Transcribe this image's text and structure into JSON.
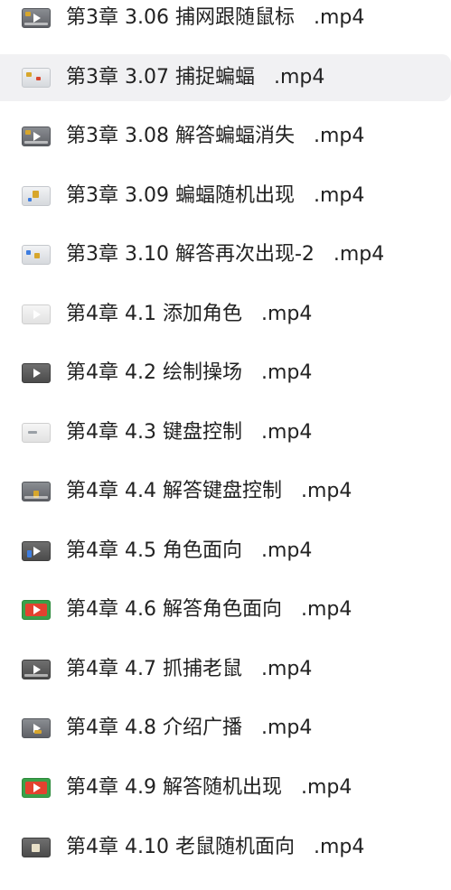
{
  "files": [
    {
      "name": "第3章 3.06 捕网跟随鼠标   .mp4",
      "thumb": "mid-gray-icon"
    },
    {
      "name": "第3章 3.07 捕捉蝙蝠   .mp4",
      "thumb": "light-gray-icon",
      "selected": true
    },
    {
      "name": "第3章 3.08 解答蝙蝠消失   .mp4",
      "thumb": "mid-gray-icon"
    },
    {
      "name": "第3章 3.09 蝙蝠随机出现   .mp4",
      "thumb": "light-gray-icon"
    },
    {
      "name": "第3章 3.10 解答再次出现-2   .mp4",
      "thumb": "light-gray-icon"
    },
    {
      "name": "第4章 4.1 添加角色   .mp4",
      "thumb": "pale-icon"
    },
    {
      "name": "第4章 4.2 绘制操场   .mp4",
      "thumb": "dark-gray-icon"
    },
    {
      "name": "第4章 4.3 键盘控制   .mp4",
      "thumb": "pale-icon"
    },
    {
      "name": "第4章 4.4 解答键盘控制   .mp4",
      "thumb": "mid-gray-icon"
    },
    {
      "name": "第4章 4.5 角色面向   .mp4",
      "thumb": "dark-gray-icon"
    },
    {
      "name": "第4章 4.6 解答角色面向   .mp4",
      "thumb": "green-red-icon"
    },
    {
      "name": "第4章 4.7 抓捕老鼠   .mp4",
      "thumb": "dark-gray-icon"
    },
    {
      "name": "第4章 4.8 介绍广播   .mp4",
      "thumb": "mid-gray-icon"
    },
    {
      "name": "第4章 4.9 解答随机出现   .mp4",
      "thumb": "green-red-icon"
    },
    {
      "name": "第4章 4.10 老鼠随机面向   .mp4",
      "thumb": "dark-gray-icon"
    }
  ]
}
